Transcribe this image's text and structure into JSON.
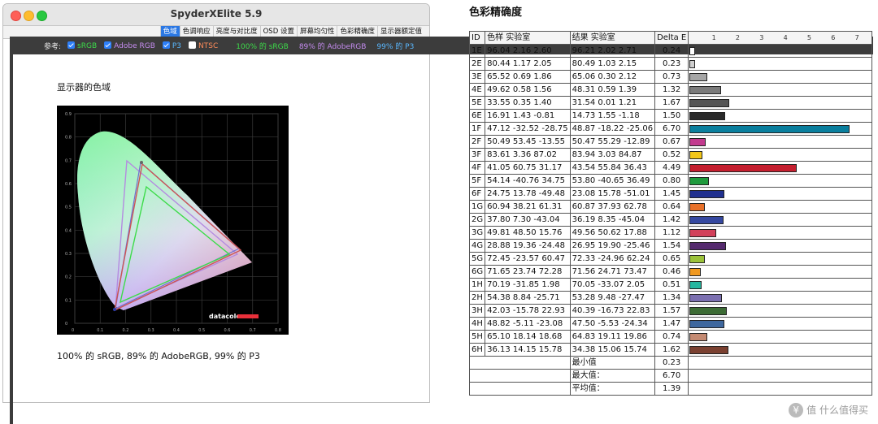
{
  "window": {
    "title": "SpyderXElite 5.9",
    "tabs": [
      "色域",
      "色调响应",
      "亮度与对比度",
      "OSD 设置",
      "屏幕均匀性",
      "色彩精确度",
      "显示器额定值"
    ],
    "active_tab": 0
  },
  "reference": {
    "label": "参考:",
    "options": [
      {
        "label": "sRGB",
        "checked": true,
        "color": "#3ddc4a"
      },
      {
        "label": "Adobe RGB",
        "checked": true,
        "color": "#c58cf0"
      },
      {
        "label": "P3",
        "checked": true,
        "color": "#5ab8ff"
      },
      {
        "label": "NTSC",
        "checked": false,
        "color": "#ff8c5a"
      }
    ],
    "stats": [
      {
        "text": "100% 的 sRGB",
        "color": "#3ddc4a"
      },
      {
        "text": "89% 的 AdobeRGB",
        "color": "#c58cf0"
      },
      {
        "text": "99% 的 P3",
        "color": "#5ab8ff"
      }
    ]
  },
  "gamut": {
    "heading": "显示器的色域",
    "summary": "100% 的 sRGB, 89% 的 AdobeRGB, 99% 的 P3",
    "y_ticks": [
      "0.9",
      "0.8",
      "0.7",
      "0.6",
      "0.5",
      "0.4",
      "0.3",
      "0.2",
      "0.1",
      "0"
    ],
    "x_ticks": [
      "0",
      "0.1",
      "0.2",
      "0.3",
      "0.4",
      "0.5",
      "0.6",
      "0.7",
      "0.8"
    ],
    "logo": "datacolor"
  },
  "accuracy": {
    "title": "色彩精确度",
    "headers": {
      "id": "ID",
      "sample": "色样 实验室",
      "result": "结果 实验室",
      "delta": "Delta E"
    },
    "scale": [
      "1",
      "2",
      "3",
      "4",
      "5",
      "6",
      "7"
    ],
    "rows": [
      {
        "id": "1E",
        "sample": "96.04  2.16  2.60",
        "result": "96.21  2.02  2.71",
        "delta": "0.24",
        "color": "#ffffff"
      },
      {
        "id": "2E",
        "sample": "80.44  1.17  2.05",
        "result": "80.49  1.03  2.15",
        "delta": "0.23",
        "color": "#cfcfcf"
      },
      {
        "id": "3E",
        "sample": "65.52  0.69  1.86",
        "result": "65.06  0.30  2.12",
        "delta": "0.73",
        "color": "#a6a6a6"
      },
      {
        "id": "4E",
        "sample": "49.62  0.58  1.56",
        "result": "48.31  0.59  1.39",
        "delta": "1.32",
        "color": "#7a7a7a"
      },
      {
        "id": "5E",
        "sample": "33.55  0.35  1.40",
        "result": "31.54  0.01  1.21",
        "delta": "1.67",
        "color": "#555555"
      },
      {
        "id": "6E",
        "sample": "16.91  1.43  -0.81",
        "result": "14.73  1.55  -1.18",
        "delta": "1.50",
        "color": "#2a2a2a"
      },
      {
        "id": "1F",
        "sample": "47.12 -32.52 -28.75",
        "result": "48.87 -18.22 -25.06",
        "delta": "6.70",
        "color": "#0a7f9e"
      },
      {
        "id": "2F",
        "sample": "50.49  53.45 -13.55",
        "result": "50.47  55.29 -12.89",
        "delta": "0.67",
        "color": "#c23a8e"
      },
      {
        "id": "3F",
        "sample": "83.61  3.36  87.02",
        "result": "83.94  3.03  84.87",
        "delta": "0.52",
        "color": "#f2c618"
      },
      {
        "id": "4F",
        "sample": "41.05  60.75  31.17",
        "result": "43.54  55.84  36.43",
        "delta": "4.49",
        "color": "#c41e2e"
      },
      {
        "id": "5F",
        "sample": "54.14 -40.76  34.75",
        "result": "53.80 -40.65  36.49",
        "delta": "0.80",
        "color": "#1e9a3c"
      },
      {
        "id": "6F",
        "sample": "24.75  13.78 -49.48",
        "result": "23.08  15.78 -51.01",
        "delta": "1.45",
        "color": "#1f2f8f"
      },
      {
        "id": "1G",
        "sample": "60.94  38.21  61.31",
        "result": "60.87  37.93  62.78",
        "delta": "0.64",
        "color": "#e8712a"
      },
      {
        "id": "2G",
        "sample": "37.80  7.30 -43.04",
        "result": "36.19  8.35 -45.04",
        "delta": "1.42",
        "color": "#3548a0"
      },
      {
        "id": "3G",
        "sample": "49.81  48.50  15.76",
        "result": "49.56  50.62  17.88",
        "delta": "1.12",
        "color": "#d2405a"
      },
      {
        "id": "4G",
        "sample": "28.88  19.36 -24.48",
        "result": "26.95  19.90 -25.46",
        "delta": "1.54",
        "color": "#552a6e"
      },
      {
        "id": "5G",
        "sample": "72.45 -23.57  60.47",
        "result": "72.33 -24.96  62.24",
        "delta": "0.65",
        "color": "#9bc23a"
      },
      {
        "id": "6G",
        "sample": "71.65  23.74  72.28",
        "result": "71.56  24.71  73.47",
        "delta": "0.46",
        "color": "#f0981e"
      },
      {
        "id": "1H",
        "sample": "70.19 -31.85  1.98",
        "result": "70.05 -33.07  2.05",
        "delta": "0.51",
        "color": "#26b7a0"
      },
      {
        "id": "2H",
        "sample": "54.38  8.84 -25.71",
        "result": "53.28  9.48 -27.47",
        "delta": "1.34",
        "color": "#7b6fb0"
      },
      {
        "id": "3H",
        "sample": "42.03 -15.78  22.93",
        "result": "40.39 -16.73  22.83",
        "delta": "1.57",
        "color": "#3c6b34"
      },
      {
        "id": "4H",
        "sample": "48.82 -5.11 -23.08",
        "result": "47.50 -5.53 -24.34",
        "delta": "1.47",
        "color": "#3e679e"
      },
      {
        "id": "5H",
        "sample": "65.10  18.14  18.68",
        "result": "64.83  19.11  19.86",
        "delta": "0.74",
        "color": "#c48a72"
      },
      {
        "id": "6H",
        "sample": "36.13  14.15  15.78",
        "result": "34.38  15.06  15.74",
        "delta": "1.62",
        "color": "#7a4030"
      }
    ],
    "footer": [
      {
        "label": "最小值",
        "value": "0.23"
      },
      {
        "label": "最大值：",
        "value": "6.70"
      },
      {
        "label": "平均值：",
        "value": "1.39"
      }
    ]
  },
  "watermark": "值 什么值得买"
}
